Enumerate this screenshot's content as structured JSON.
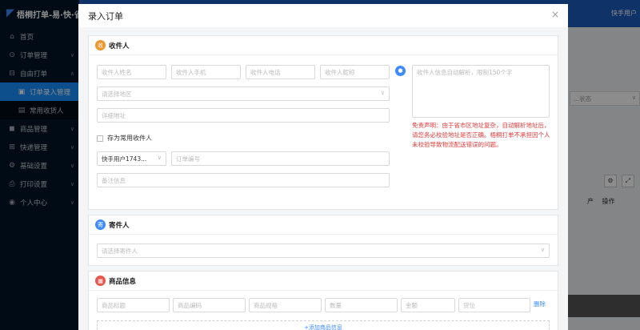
{
  "app": {
    "logo": "梧桐打单-易·快·省"
  },
  "sidebar": {
    "items": [
      {
        "label": "首页",
        "icon": "home-icon",
        "glyph": "⌂"
      },
      {
        "label": "订单管理",
        "icon": "order-icon",
        "glyph": "⊙",
        "caret": "∨"
      },
      {
        "label": "自由打单",
        "icon": "print-free-icon",
        "glyph": "⊟",
        "caret": "∧"
      },
      {
        "label": "订单录入管理",
        "icon": "order-entry-icon",
        "glyph": "▣"
      },
      {
        "label": "常用收货人",
        "icon": "contacts-icon",
        "glyph": "▤"
      },
      {
        "label": "商品管理",
        "icon": "goods-icon",
        "glyph": "◼",
        "caret": "∨"
      },
      {
        "label": "快递管理",
        "icon": "express-icon",
        "glyph": "⊞",
        "caret": "∨"
      },
      {
        "label": "基础设置",
        "icon": "settings-icon",
        "glyph": "⚙",
        "caret": "∨"
      },
      {
        "label": "打印设置",
        "icon": "printer-icon",
        "glyph": "⎙",
        "caret": "∨"
      },
      {
        "label": "个人中心",
        "icon": "user-center-icon",
        "glyph": "◉",
        "caret": "∨"
      }
    ]
  },
  "topbar": {
    "user": "快手用户"
  },
  "background": {
    "status_select": "...状态",
    "col_product": "产",
    "col_action": "操作",
    "settings_glyph": "⚙",
    "fullscreen_glyph": "⤢"
  },
  "modal": {
    "title": "录入订单",
    "close": "×",
    "receiver": {
      "title": "收件人",
      "badge": "收",
      "name_placeholder": "收件人姓名",
      "mobile_placeholder": "收件人手机",
      "phone_placeholder": "收件人电话",
      "nickname_placeholder": "收件人昵称",
      "region_placeholder": "请选择地区",
      "address_placeholder": "详细地址",
      "save_label": "存为常用收件人",
      "shop_value": "快手用户1743...",
      "order_no_placeholder": "订单编号",
      "remark_placeholder": "备注信息",
      "parse_placeholder": "收件人信息自动解析，限制150个字",
      "disclaimer": "免责声明：由于省市区地址复杂，自动解析地址后，请您务必校验地址是否正确。梧桐打单不承担因个人未校验导致物流配送错误的问题。"
    },
    "sender": {
      "title": "寄件人",
      "badge": "寄",
      "select_placeholder": "请选择寄件人"
    },
    "goods": {
      "title": "商品信息",
      "badge": "▦",
      "fields": [
        "商品标题",
        "商品编码",
        "商品规格",
        "数量",
        "金额",
        "货位"
      ],
      "delete_label": "删除",
      "add_label": "+添加商品信息"
    }
  },
  "colors": {
    "sidebar_bg": "#001529",
    "active": "#1890ff",
    "receiver_badge": "#f0952a",
    "sender_badge": "#3d8bff",
    "goods_badge": "#e8564c",
    "disclaimer": "#e43b3b"
  }
}
